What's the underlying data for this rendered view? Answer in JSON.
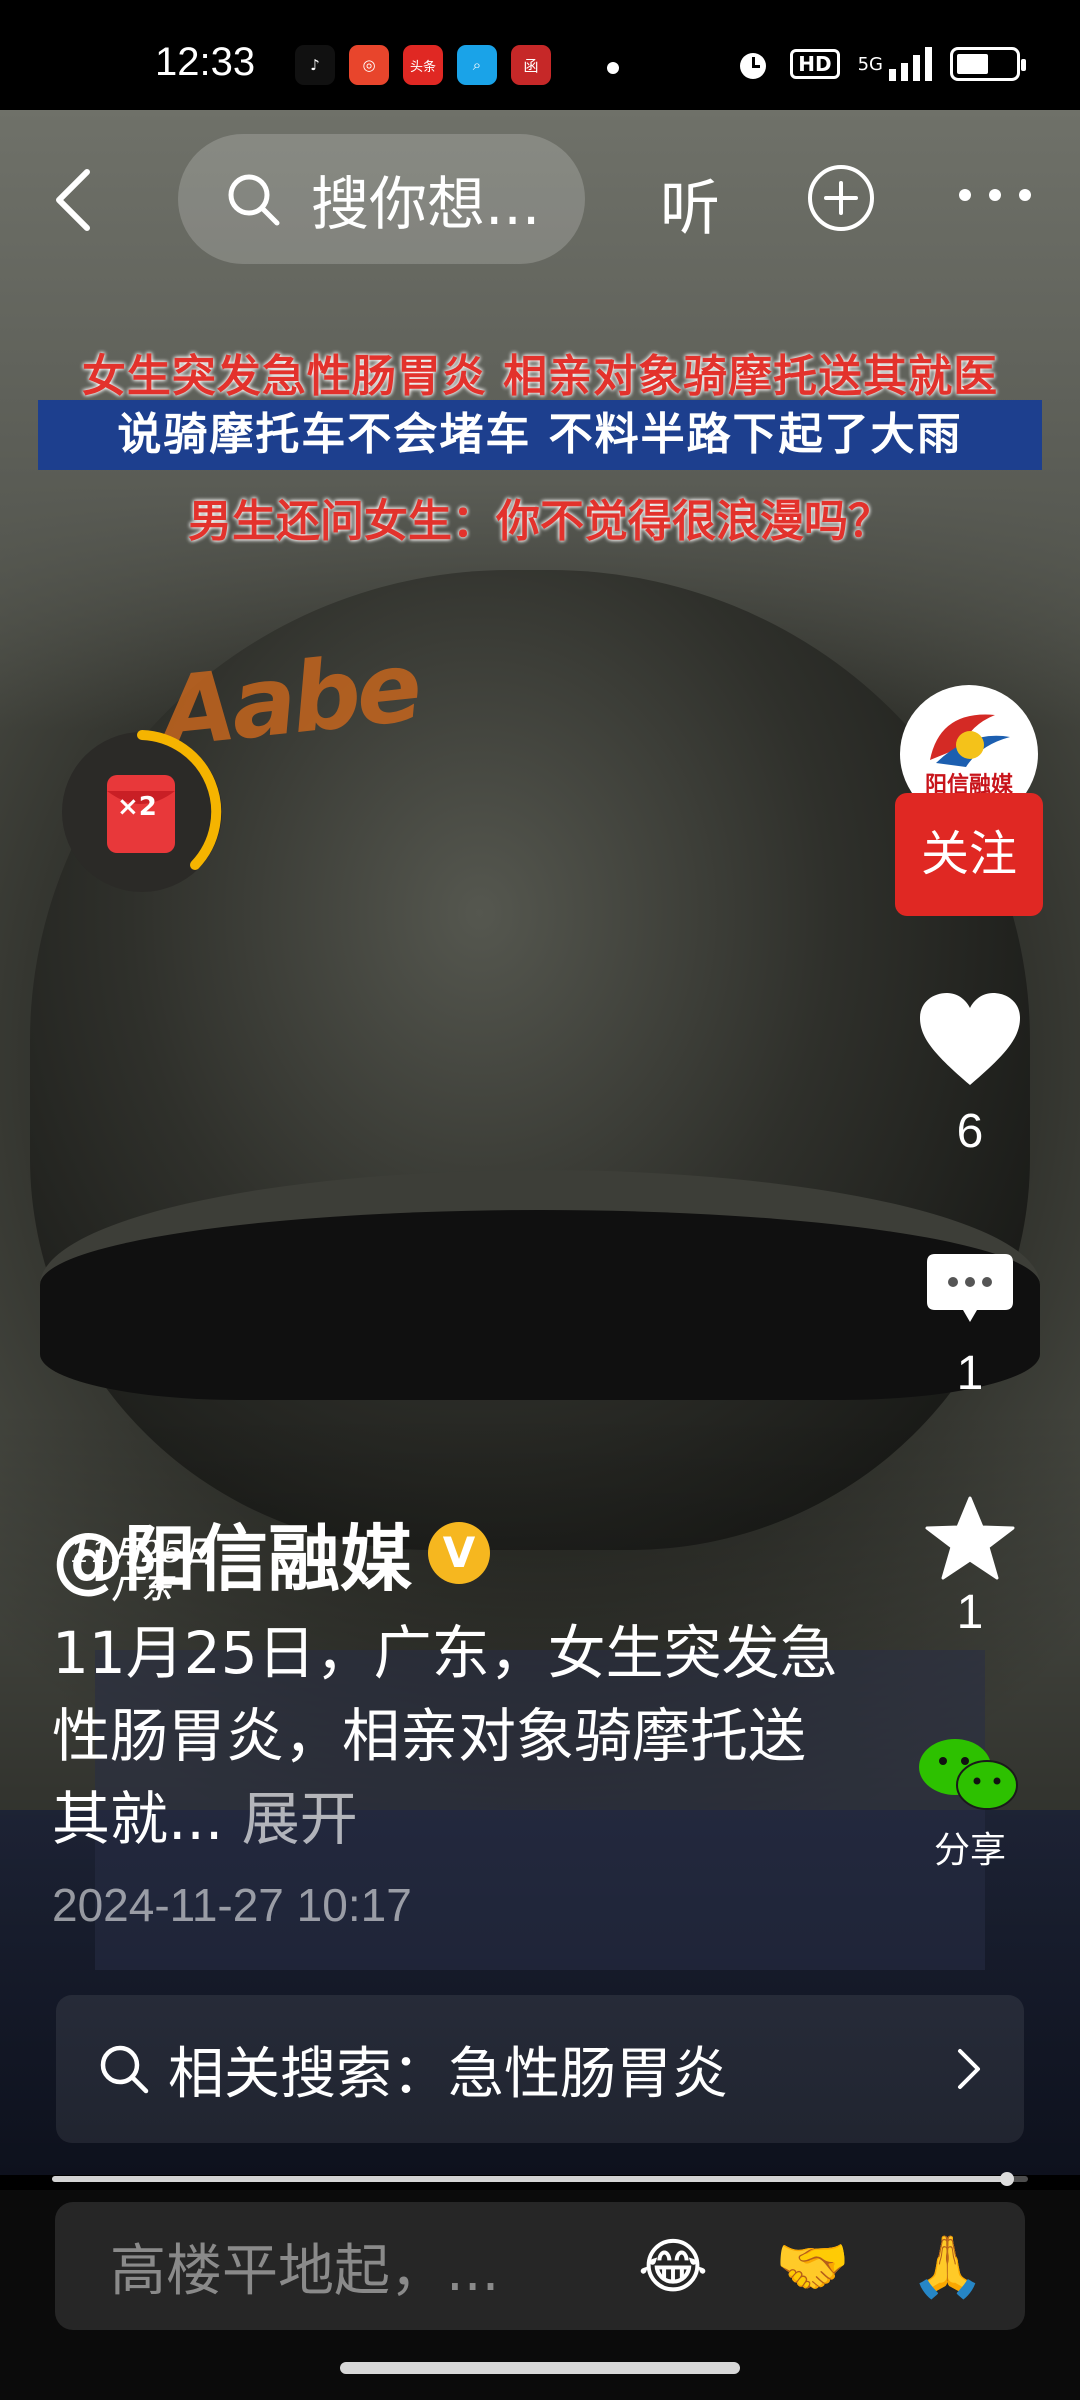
{
  "status_bar": {
    "time": "12:33",
    "apps": [
      {
        "icon": "tiktok-icon",
        "color": "#111111",
        "glyph": "♪"
      },
      {
        "icon": "camera-app-icon",
        "color": "#e8452c",
        "glyph": "◎"
      },
      {
        "icon": "toutiao-icon",
        "color": "#e02823",
        "glyph": "头条"
      },
      {
        "icon": "search-app-icon",
        "color": "#1aa3e8",
        "glyph": "⌕"
      },
      {
        "icon": "news-app-icon",
        "color": "#c62828",
        "glyph": "函"
      }
    ],
    "hd": "HD",
    "network": "5G"
  },
  "top_nav": {
    "search_placeholder": "搜你想...",
    "listen_label": "听"
  },
  "video": {
    "caption_line1": "女生突发急性肠胃炎 相亲对象骑摩托送其就医",
    "caption_line2": "说骑摩托车不会堵车 不料半路下起了大雨",
    "caption_line3": "男生还问女生：你不觉得很浪漫吗？",
    "date_stamp_line1": "11月25日",
    "date_stamp_line2": "广东",
    "red_packet_multiplier": "×2"
  },
  "right_rail": {
    "avatar_label": "阳信融媒",
    "follow_label": "关注",
    "like_count": "6",
    "comment_count": "1",
    "favorite_count": "1",
    "share_label": "分享"
  },
  "post": {
    "author": "@阳信融媒",
    "verified_glyph": "V",
    "description": "11月25日，广东，女生突发急性肠胃炎，相亲对象骑摩托送其就... ",
    "expand_label": "展开",
    "timestamp": "2024-11-27 10:17"
  },
  "related_search": {
    "label": "相关搜索：急性肠胃炎"
  },
  "progress": 0.98,
  "comment_bar": {
    "placeholder": "高楼平地起，...",
    "emojis": [
      "😂",
      "🤝",
      "🙏"
    ]
  },
  "colors": {
    "follow_red": "#e02823",
    "verified_gold": "#f6b71f",
    "caption_red": "#e3322c",
    "caption_band_blue": "#1d3f8e"
  }
}
